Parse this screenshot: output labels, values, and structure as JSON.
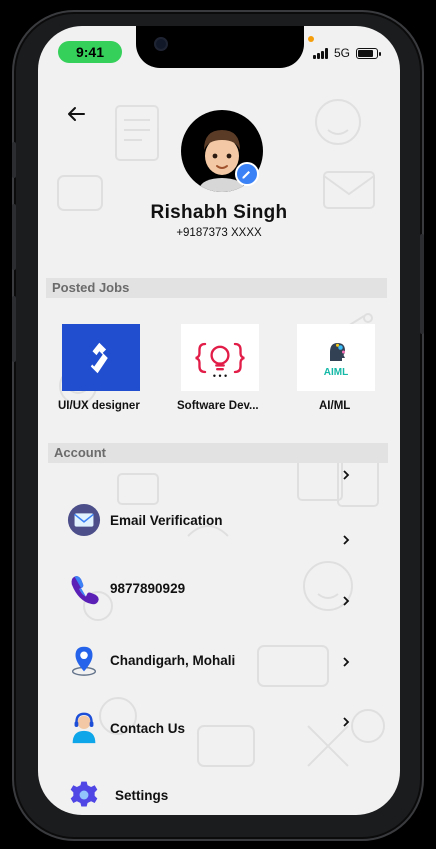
{
  "status_bar": {
    "time": "9:41",
    "network": "5G"
  },
  "profile": {
    "name": "Rishabh Singh",
    "phone": "+9187373 XXXX"
  },
  "sections": {
    "posted_jobs": "Posted Jobs",
    "account": "Account"
  },
  "jobs": [
    {
      "label": "UI/UX designer",
      "icon": "toptal-logo"
    },
    {
      "label": "Software Dev...",
      "icon": "code-bulb-logo"
    },
    {
      "label": "AI/ML",
      "icon": "aiml-head-logo",
      "logo_text": "AIML"
    }
  ],
  "account_items": [
    {
      "label": "Email Verification",
      "icon": "email-icon"
    },
    {
      "label": "9877890929",
      "icon": "phone-icon"
    },
    {
      "label": "Chandigarh, Mohali",
      "icon": "location-pin-icon"
    },
    {
      "label": "Contach Us",
      "icon": "support-agent-icon"
    },
    {
      "label": "Settings",
      "icon": "gear-icon"
    }
  ],
  "colors": {
    "accent": "#3b82f6",
    "status_pill": "#35d05a",
    "toptal": "#204ecf",
    "code_logo": "#e11d48"
  }
}
